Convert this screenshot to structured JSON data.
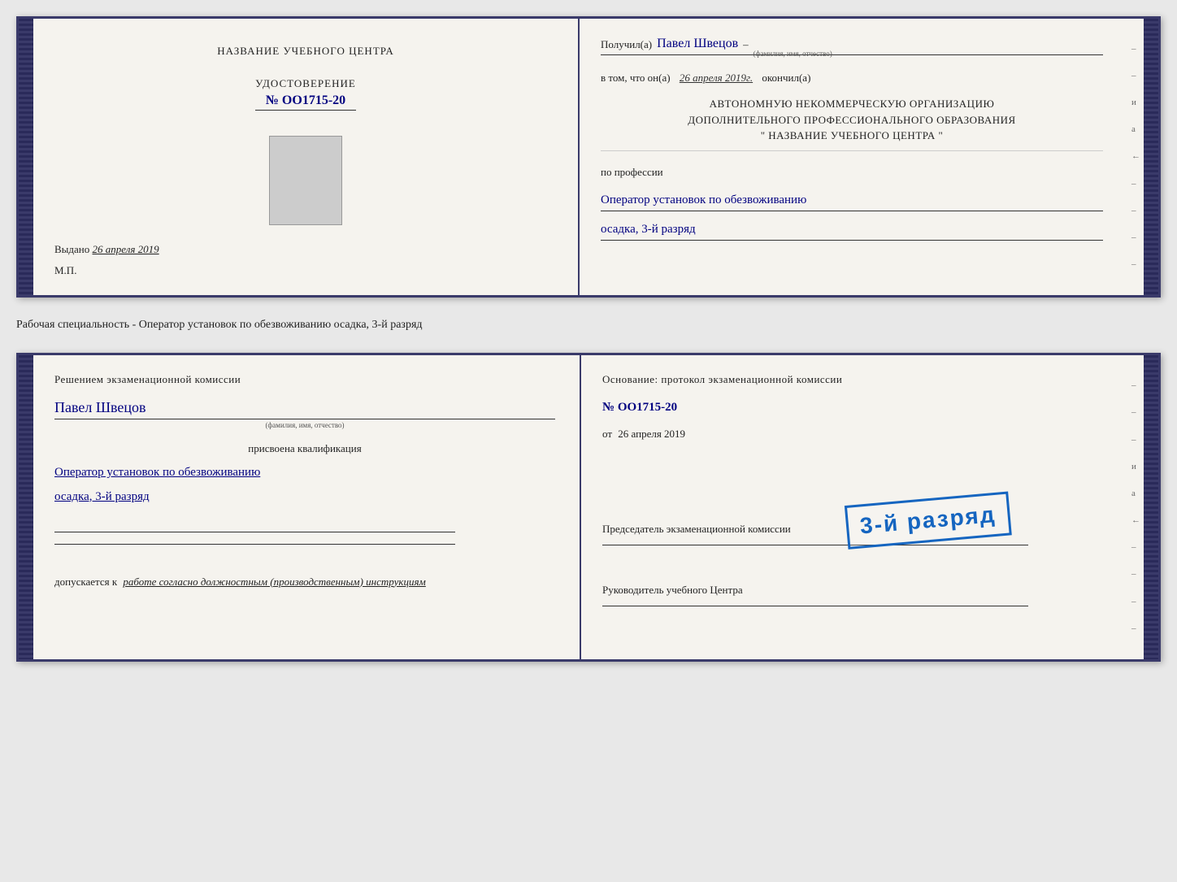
{
  "page": {
    "background": "#e8e8e8"
  },
  "top_document": {
    "left": {
      "center_title": "НАЗВАНИЕ УЧЕБНОГО ЦЕНТРА",
      "cert_label": "УДОСТОВЕРЕНИЕ",
      "cert_number": "№ OO1715-20",
      "issued_prefix": "Выдано",
      "issued_date": "26 апреля 2019",
      "mp_label": "М.П."
    },
    "right": {
      "recipient_prefix": "Получил(а)",
      "recipient_name": "Павел Швецов",
      "fio_label": "(фамилия, имя, отчество)",
      "dash": "–",
      "date_prefix": "в том, что он(а)",
      "date_value": "26 апреля 2019г.",
      "date_suffix": "окончил(а)",
      "org_line1": "АВТОНОМНУЮ НЕКОММЕРЧЕСКУЮ ОРГАНИЗАЦИЮ",
      "org_line2": "ДОПОЛНИТЕЛЬНОГО ПРОФЕССИОНАЛЬНОГО ОБРАЗОВАНИЯ",
      "org_line3": "\"  НАЗВАНИЕ УЧЕБНОГО ЦЕНТРА  \"",
      "profession_label": "по профессии",
      "profession_value": "Оператор установок по обезвоживанию",
      "rank_value": "осадка, 3-й разряд"
    }
  },
  "separator": {
    "text": "Рабочая специальность - Оператор установок по обезвоживанию осадка, 3-й разряд"
  },
  "bottom_document": {
    "left": {
      "decision_title": "Решением экзаменационной комиссии",
      "person_name": "Павел Швецов",
      "fio_label": "(фамилия, имя, отчество)",
      "assigned_label": "присвоена квалификация",
      "qual_value": "Оператор установок по обезвоживанию",
      "rank_value": "осадка, 3-й разряд",
      "допускается_prefix": "допускается к",
      "допускается_value": "работе согласно должностным (производственным) инструкциям"
    },
    "right": {
      "basis_title": "Основание: протокол экзаменационной комиссии",
      "protocol_number": "№  OO1715-20",
      "date_prefix": "от",
      "date_value": "26 апреля 2019",
      "chairman_label": "Председатель экзаменационной комиссии",
      "director_label": "Руководитель учебного Центра",
      "stamp_text": "3-й разряд"
    },
    "right_ticks": [
      "и",
      "а",
      "←",
      "–",
      "–",
      "–",
      "–"
    ]
  },
  "top_right_ticks": [
    "–",
    "–",
    "и",
    "а",
    "←",
    "–",
    "–",
    "–",
    "–"
  ]
}
